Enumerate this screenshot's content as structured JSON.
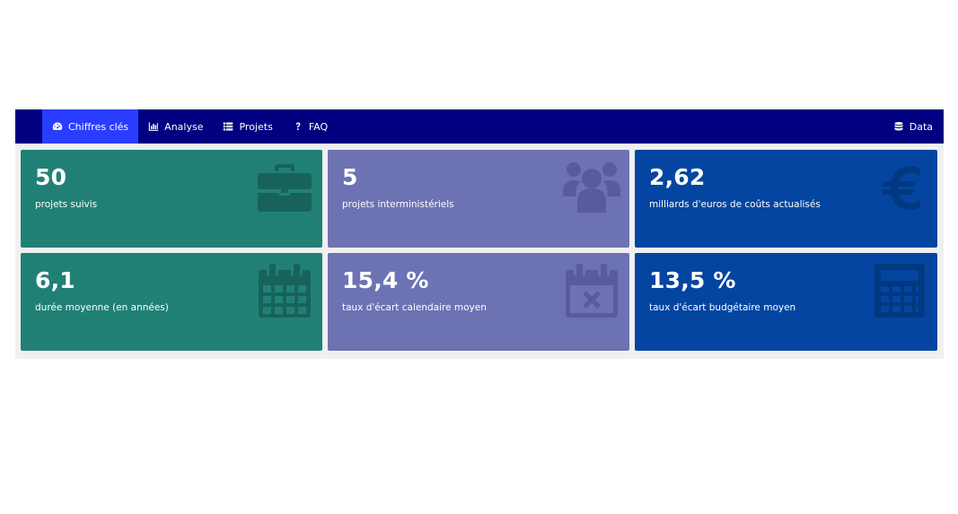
{
  "nav": {
    "items": [
      {
        "label": "Chiffres clés",
        "icon": "dashboard-gauge-icon",
        "active": true
      },
      {
        "label": "Analyse",
        "icon": "bar-chart-icon",
        "active": false
      },
      {
        "label": "Projets",
        "icon": "list-icon",
        "active": false
      },
      {
        "label": "FAQ",
        "icon": "question-icon",
        "active": false
      }
    ],
    "right": {
      "label": "Data",
      "icon": "database-icon"
    }
  },
  "cards": [
    {
      "value": "50",
      "label": "projets suivis",
      "icon": "briefcase-icon",
      "color": "#218076"
    },
    {
      "value": "5",
      "label": "projets interministériels",
      "icon": "users-icon",
      "color": "#6d72b3"
    },
    {
      "value": "2,62",
      "label": "milliards d'euros de coûts actualisés",
      "icon": "euro-icon",
      "color": "#0345a1"
    },
    {
      "value": "6,1",
      "label": "durée moyenne (en années)",
      "icon": "calendar-icon",
      "color": "#218076"
    },
    {
      "value": "15,4 %",
      "label": "taux d'écart calendaire moyen",
      "icon": "calendar-x-icon",
      "color": "#6d72b3"
    },
    {
      "value": "13,5 %",
      "label": "taux d'écart budgétaire moyen",
      "icon": "calculator-icon",
      "color": "#0345a1"
    }
  ],
  "colors": {
    "navbar": "#000080",
    "active_tab": "#2a3dff",
    "background": "#f0f0f2"
  }
}
